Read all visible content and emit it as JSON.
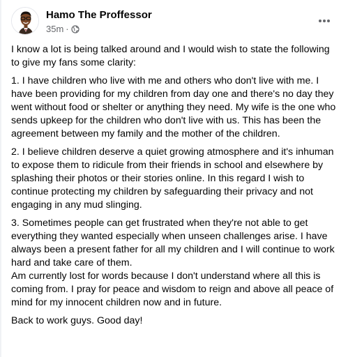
{
  "post": {
    "author": "Hamo The Proffessor",
    "time": "35m",
    "separator": "·",
    "privacy_icon": "globe-icon",
    "more_icon": "more-options-icon",
    "paragraphs": [
      "I know a lot is being talked around and I would wish to state the following to give my fans some clarity:",
      "1. I have children who live with me and others who don't live with me. I have been providing for my children from day one and there's no day they went without food or shelter or anything they need. My wife is the one who sends upkeep for the children who don't live with us. This has been the agreement between my family and the mother of the children.",
      "2. I believe children deserve a quiet growing atmosphere and it's inhuman to expose them to ridicule from their friends in school and elsewhere by splashing their photos or their stories online. In this regard I wish to continue protecting my children by safeguarding their privacy and not engaging in any mud slinging.",
      "3. Sometimes people can get frustrated when they're not able to get everything they wanted especially when unseen challenges arise. I have always been a present father for all my children and I will continue to work hard and take care of them.\nAm currently lost for words because I don't understand where all this is coming from. I pray for peace and wisdom to reign and above all peace of mind for my innocent children now and in future.",
      "Back to work guys. Good day!"
    ]
  },
  "colors": {
    "text": "#050505",
    "secondary_text": "#65676b",
    "background": "#ffffff"
  }
}
